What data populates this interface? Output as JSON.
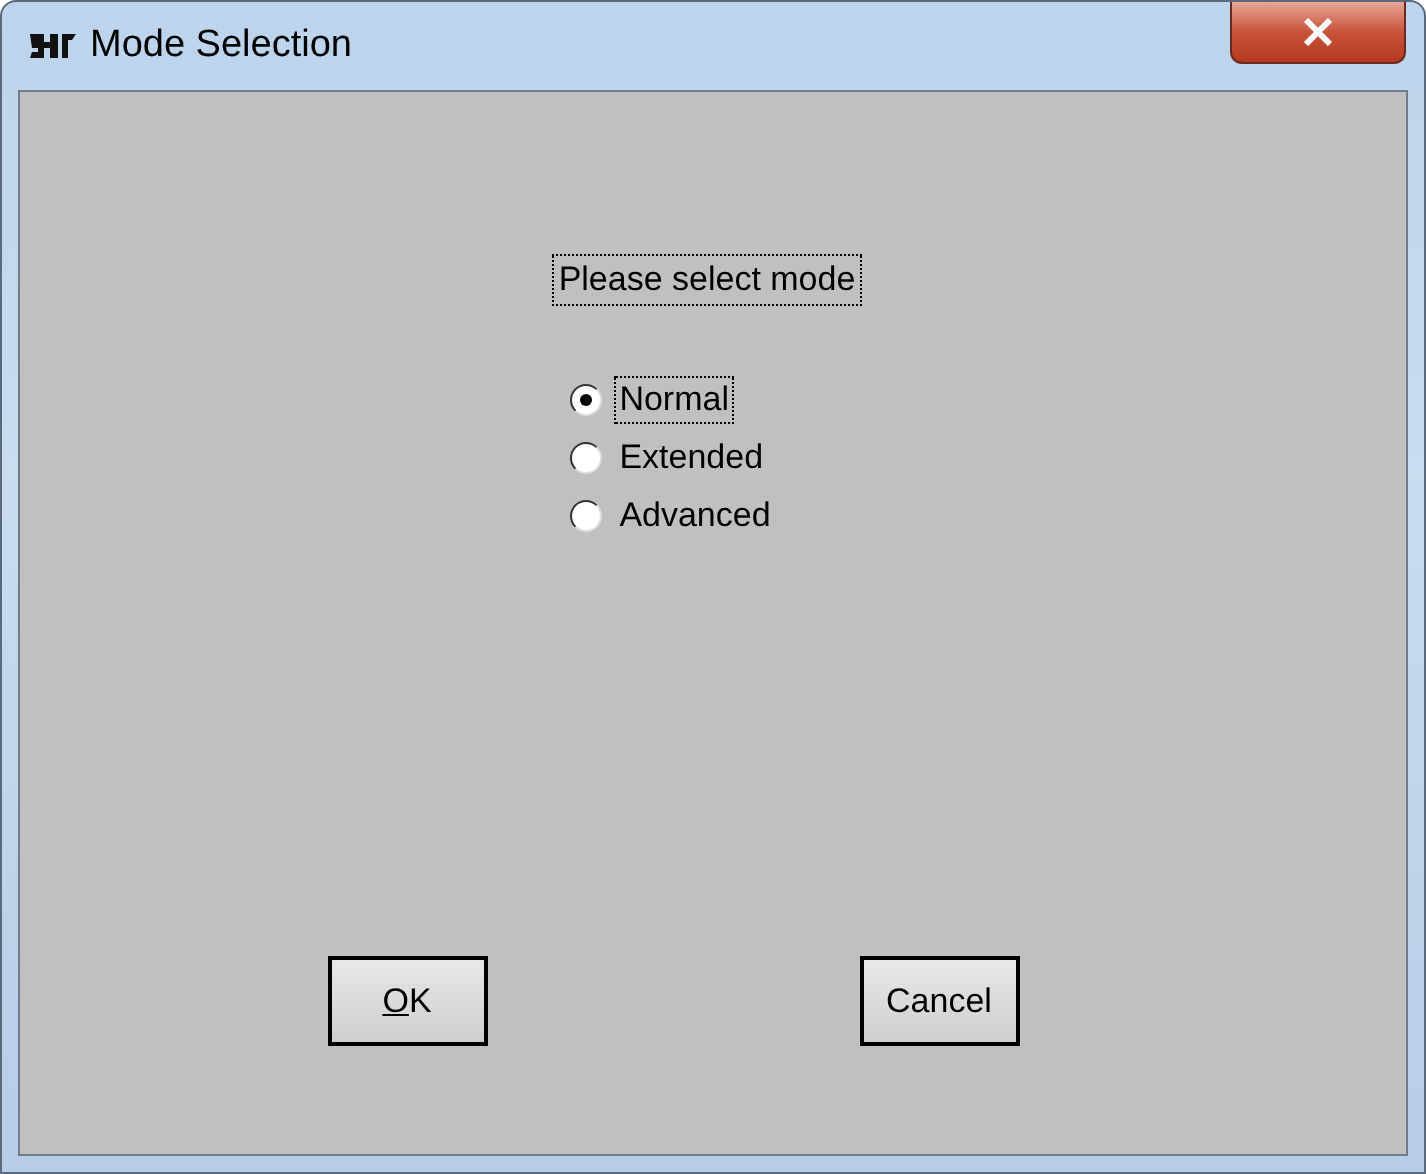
{
  "window": {
    "title": "Mode Selection"
  },
  "prompt": "Please select mode",
  "modes": [
    {
      "label": "Normal",
      "selected": true
    },
    {
      "label": "Extended",
      "selected": false
    },
    {
      "label": "Advanced",
      "selected": false
    }
  ],
  "buttons": [
    {
      "label": "OK",
      "access_key_underlined": true
    },
    {
      "label": "Cancel",
      "access_key_underlined": false
    }
  ]
}
